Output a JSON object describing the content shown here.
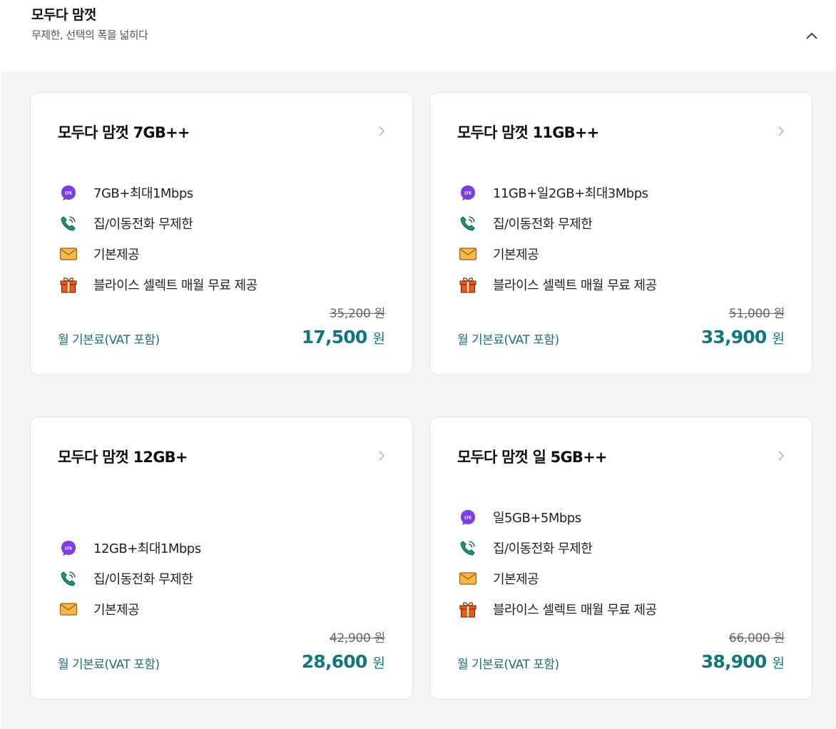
{
  "header": {
    "title": "모두다 맘껏",
    "subtitle": "무제한, 선택의 폭을 넓히다"
  },
  "colors": {
    "accent": "#13767a",
    "lte_icon": "#7b3fe4",
    "call_icon": "#1a9a7c",
    "mail_icon": "#f5b74a",
    "gift_icon": "#ea5a1c",
    "background": "#f5f5f5"
  },
  "plans": [
    {
      "title": "모두다 맘껏 7GB++",
      "features": [
        {
          "icon": "lte-icon",
          "text": "7GB+최대1Mbps"
        },
        {
          "icon": "phone-call-icon",
          "text": "집/이동전화 무제한"
        },
        {
          "icon": "message-envelope-icon",
          "text": "기본제공"
        },
        {
          "icon": "gift-icon",
          "text": "블라이스 셀렉트 매월 무료 제공"
        }
      ],
      "price_label": "월 기본료(VAT 포함)",
      "original_price": "35,200 원",
      "price": "17,500",
      "currency": "원"
    },
    {
      "title": "모두다 맘껏 11GB++",
      "features": [
        {
          "icon": "lte-icon",
          "text": "11GB+일2GB+최대3Mbps"
        },
        {
          "icon": "phone-call-icon",
          "text": "집/이동전화 무제한"
        },
        {
          "icon": "message-envelope-icon",
          "text": "기본제공"
        },
        {
          "icon": "gift-icon",
          "text": "블라이스 셀렉트 매월 무료 제공"
        }
      ],
      "price_label": "월 기본료(VAT 포함)",
      "original_price": "51,000 원",
      "price": "33,900",
      "currency": "원"
    },
    {
      "title": "모두다 맘껏 12GB+",
      "features": [
        {
          "icon": "lte-icon",
          "text": "12GB+최대1Mbps"
        },
        {
          "icon": "phone-call-icon",
          "text": "집/이동전화 무제한"
        },
        {
          "icon": "message-envelope-icon",
          "text": "기본제공"
        }
      ],
      "price_label": "월 기본료(VAT 포함)",
      "original_price": "42,900 원",
      "price": "28,600",
      "currency": "원"
    },
    {
      "title": "모두다 맘껏 일 5GB++",
      "features": [
        {
          "icon": "lte-icon",
          "text": "일5GB+5Mbps"
        },
        {
          "icon": "phone-call-icon",
          "text": "집/이동전화 무제한"
        },
        {
          "icon": "message-envelope-icon",
          "text": "기본제공"
        },
        {
          "icon": "gift-icon",
          "text": "블라이스 셀렉트 매월 무료 제공"
        }
      ],
      "price_label": "월 기본료(VAT 포함)",
      "original_price": "66,000 원",
      "price": "38,900",
      "currency": "원"
    }
  ]
}
